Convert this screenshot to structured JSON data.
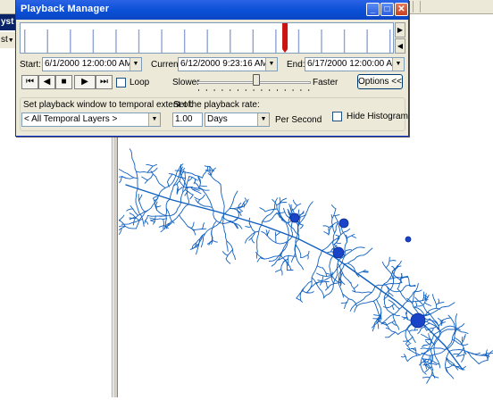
{
  "window": {
    "title": "Playback Manager",
    "controls": {
      "minimize": "_",
      "maximize": "□",
      "close": "✕"
    }
  },
  "histogram": {
    "current_position_fraction": 0.71,
    "scroll_right": "▶",
    "scroll_left": "◀"
  },
  "time": {
    "start_label": "Start:",
    "start_value": "6/1/2000 12:00:00 AM",
    "current_label": "Current:",
    "current_value": "6/12/2000 9:23:16 AM",
    "end_label": "End:",
    "end_value": "6/17/2000 12:00:00 AM"
  },
  "playback": {
    "first": "⏮",
    "back": "◀",
    "stop": "■",
    "play": "▶",
    "last": "⏭",
    "loop_label": "Loop",
    "slower_label": "Slower",
    "faster_label": "Faster",
    "speed_fraction": 0.52,
    "options_label": "Options <<"
  },
  "extent": {
    "label": "Set playback window to temporal extent of:",
    "value": "< All Temporal Layers >"
  },
  "rate": {
    "label": "Set the playback rate:",
    "value": "1.00",
    "unit": "Days",
    "per_label": "Per Second"
  },
  "hide_histogram_label": "Hide Histogram",
  "background": {
    "left_tab_text": "yst",
    "left_text": "st",
    "river_color": "#1060c0",
    "station_color": "#1a44c8"
  }
}
